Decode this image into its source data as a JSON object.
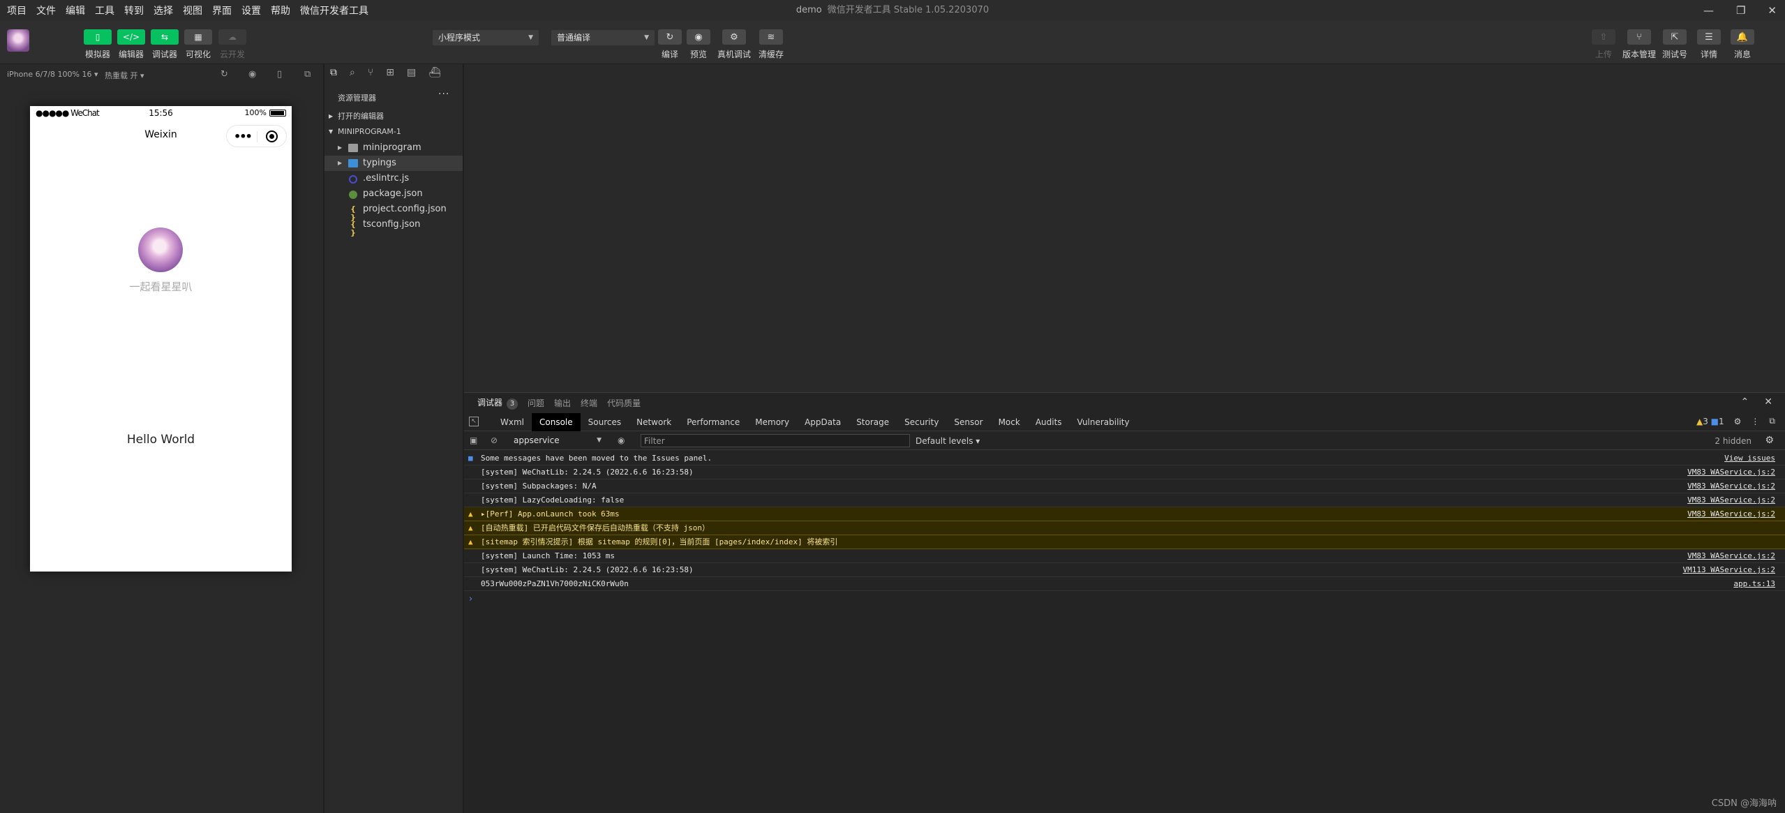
{
  "menu": [
    "项目",
    "文件",
    "编辑",
    "工具",
    "转到",
    "选择",
    "视图",
    "界面",
    "设置",
    "帮助",
    "微信开发者工具"
  ],
  "window": {
    "project": "demo",
    "app": "微信开发者工具 Stable 1.05.2203070"
  },
  "toolbar": {
    "left_buttons": [
      {
        "label": "模拟器",
        "glyph": "▯"
      },
      {
        "label": "编辑器",
        "glyph": "</>"
      },
      {
        "label": "调试器",
        "glyph": "⇆"
      },
      {
        "label": "可视化",
        "glyph": "▦"
      },
      {
        "label": "云开发",
        "glyph": "☁"
      }
    ],
    "mode_select": "小程序模式",
    "compile_select": "普通编译",
    "center_buttons": [
      {
        "label": "编译",
        "glyph": "↻"
      },
      {
        "label": "预览",
        "glyph": "◉"
      },
      {
        "label": "真机调试",
        "glyph": "⚙"
      },
      {
        "label": "清缓存",
        "glyph": "≋"
      }
    ],
    "right_buttons": [
      {
        "label": "上传",
        "glyph": "⇧"
      },
      {
        "label": "版本管理",
        "glyph": "⑂"
      },
      {
        "label": "测试号",
        "glyph": "⇱"
      },
      {
        "label": "详情",
        "glyph": "☰"
      },
      {
        "label": "消息",
        "glyph": "🔔"
      }
    ]
  },
  "simulator": {
    "device": "iPhone 6/7/8 100% 16 ▾",
    "hot_reload": "热重载 开 ▾",
    "status": {
      "signal": "●●●●● WeChat",
      "time": "15:56",
      "battery": "100%"
    },
    "nav_title": "Weixin",
    "nickname": "一起看星星叭",
    "hello": "Hello World"
  },
  "explorer": {
    "title": "资源管理器",
    "sections": [
      "打开的编辑器",
      "MINIPROGRAM-1"
    ],
    "files": [
      {
        "name": "miniprogram",
        "type": "folder",
        "expandable": true
      },
      {
        "name": "typings",
        "type": "folder-blue",
        "expandable": true,
        "selected": true
      },
      {
        "name": ".eslintrc.js",
        "type": "eslint"
      },
      {
        "name": "package.json",
        "type": "npm"
      },
      {
        "name": "project.config.json",
        "type": "json"
      },
      {
        "name": "tsconfig.json",
        "type": "json"
      }
    ]
  },
  "debugger": {
    "tabs": [
      {
        "label": "调试器",
        "badge": "3",
        "active": true
      },
      {
        "label": "问题"
      },
      {
        "label": "输出"
      },
      {
        "label": "终端"
      },
      {
        "label": "代码质量"
      }
    ],
    "devtools_tabs": [
      "Wxml",
      "Console",
      "Sources",
      "Network",
      "Performance",
      "Memory",
      "AppData",
      "Storage",
      "Security",
      "Sensor",
      "Mock",
      "Audits",
      "Vulnerability"
    ],
    "active_devtools_tab": "Console",
    "warn_count": "3",
    "info_count": "1",
    "context": "appservice",
    "filter_placeholder": "Filter",
    "levels": "Default levels ▾",
    "hidden": "2 hidden",
    "logs": [
      {
        "level": "info",
        "msg": "Some messages have been moved to the Issues panel.",
        "src": "View issues"
      },
      {
        "level": "log",
        "msg": "[system] WeChatLib: 2.24.5 (2022.6.6 16:23:58)",
        "src": "VM83 WAService.js:2"
      },
      {
        "level": "log",
        "msg": "[system] Subpackages: N/A",
        "src": "VM83 WAService.js:2"
      },
      {
        "level": "log",
        "msg": "[system] LazyCodeLoading: false",
        "src": "VM83 WAService.js:2"
      },
      {
        "level": "warn",
        "msg": "▸[Perf] App.onLaunch took 63ms",
        "src": "VM83 WAService.js:2"
      },
      {
        "level": "warn",
        "msg": "[自动热重载] 已开启代码文件保存后自动热重载（不支持 json）",
        "src": ""
      },
      {
        "level": "warn",
        "msg": "[sitemap 索引情况提示] 根据 sitemap 的规则[0]，当前页面 [pages/index/index] 将被索引",
        "src": ""
      },
      {
        "level": "log",
        "msg": "[system] Launch Time: 1053 ms",
        "src": "VM83 WAService.js:2"
      },
      {
        "level": "log",
        "msg": "[system] WeChatLib: 2.24.5 (2022.6.6 16:23:58)",
        "src": "VM113 WAService.js:2"
      },
      {
        "level": "log",
        "msg": "053rWu000zPaZN1Vh7000zNiCK0rWu0n",
        "src": "app.ts:13"
      }
    ]
  },
  "watermark": "CSDN @海海呐",
  "colors": {
    "accent": "#07c160",
    "warn": "#f2c037",
    "info": "#4a8fe8"
  }
}
